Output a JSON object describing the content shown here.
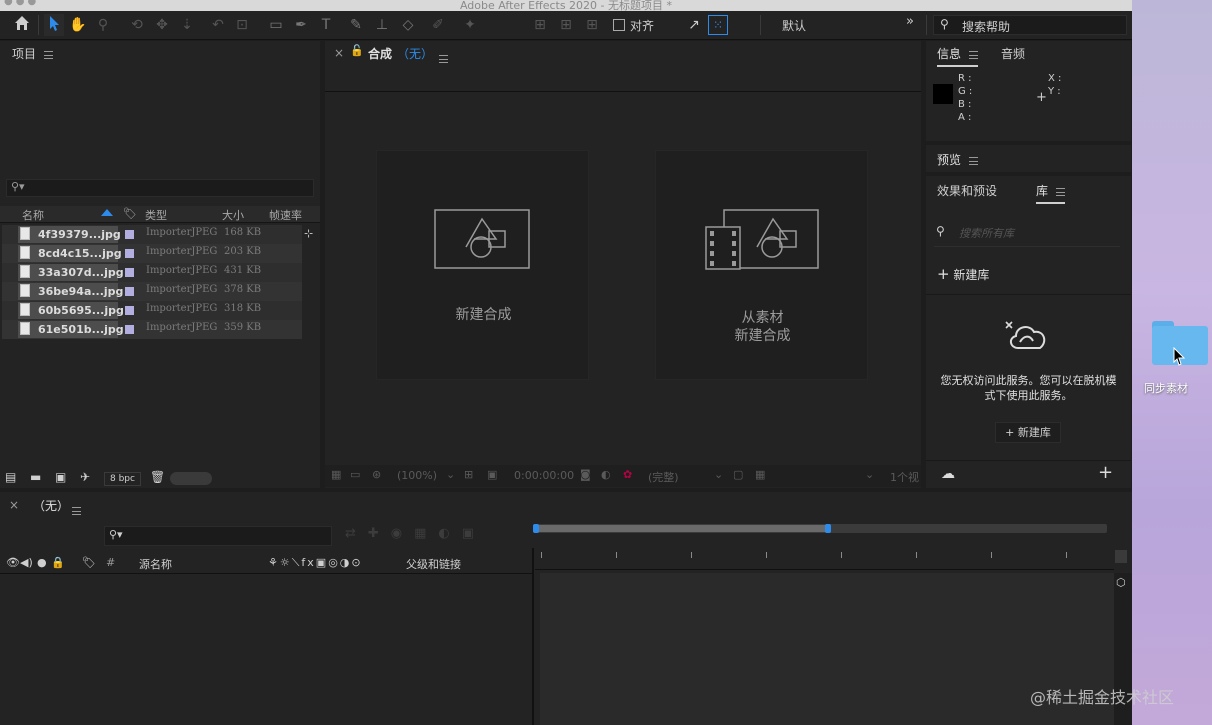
{
  "window": {
    "title": "Adobe After Effects 2020 - 无标题项目 *"
  },
  "toolbar": {
    "align_label": "对齐",
    "workspace": "默认",
    "search_placeholder": "搜索帮助"
  },
  "project": {
    "title": "项目",
    "columns": {
      "name": "名称",
      "type": "类型",
      "size": "大小",
      "fps": "帧速率"
    },
    "files": [
      {
        "name": "4f39379...jpg",
        "type": "ImporterJPEG",
        "size": "168 KB"
      },
      {
        "name": "8cd4c15...jpg",
        "type": "ImporterJPEG",
        "size": "203 KB"
      },
      {
        "name": "33a307d...jpg",
        "type": "ImporterJPEG",
        "size": "431 KB"
      },
      {
        "name": "36be94a...jpg",
        "type": "ImporterJPEG",
        "size": "378 KB"
      },
      {
        "name": "60b5695...jpg",
        "type": "ImporterJPEG",
        "size": "318 KB"
      },
      {
        "name": "61e501b...jpg",
        "type": "ImporterJPEG",
        "size": "359 KB"
      }
    ],
    "bpc": "8 bpc"
  },
  "comp": {
    "tab_label": "合成",
    "tab_value": "（无）",
    "new_comp": "新建合成",
    "from_footage_line1": "从素材",
    "from_footage_line2": "新建合成",
    "footer": {
      "zoom": "(100%)",
      "timecode": "0:00:00:00",
      "quality": "(完整)",
      "views": "1个视"
    }
  },
  "info": {
    "tab_info": "信息",
    "tab_audio": "音频",
    "r": "R :",
    "g": "G :",
    "b": "B :",
    "a": "A :",
    "x": "X :",
    "y": "Y :"
  },
  "preview": {
    "title": "预览"
  },
  "effects": {
    "title": "效果和预设"
  },
  "library": {
    "title": "库",
    "search_placeholder": "搜索所有库",
    "new_library": "新建库",
    "no_access_line1": "您无权访问此服务。您可以在脱机模",
    "no_access_line2": "式下使用此服务。",
    "new_library_button": "+ 新建库"
  },
  "timeline": {
    "tab_label": "（无）",
    "columns": {
      "source_name": "源名称",
      "parent": "父级和链接",
      "hash": "#"
    }
  },
  "desktop": {
    "folder_label": "同步素材"
  },
  "watermark": "@稀土掘金技术社区",
  "colors": {
    "accent": "#2d8ceb",
    "label_swatch": "#b3aee0",
    "folder": "#67b8ef"
  }
}
